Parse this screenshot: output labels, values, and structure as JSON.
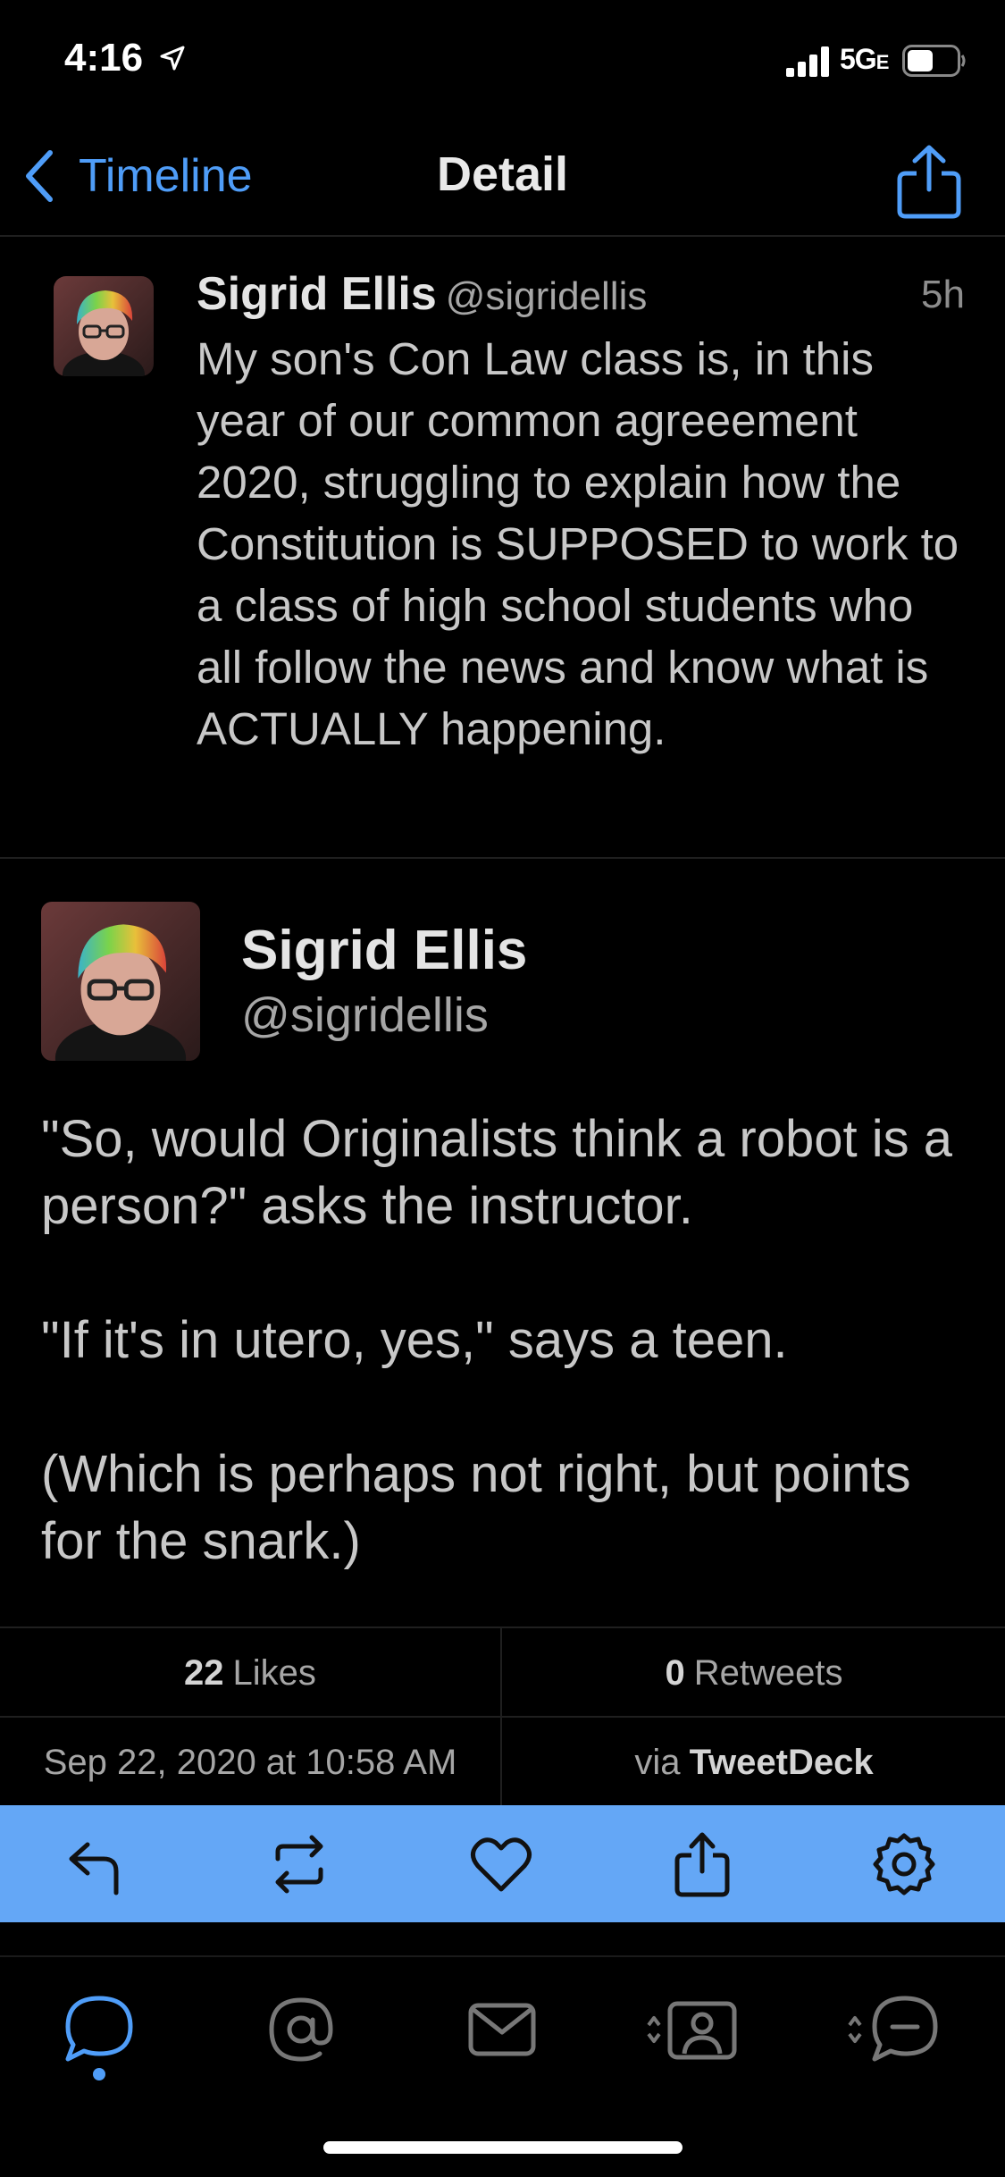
{
  "status_bar": {
    "time": "4:16",
    "network": "5G",
    "network_suffix": "E"
  },
  "nav": {
    "back_label": "Timeline",
    "title": "Detail"
  },
  "parent_tweet": {
    "name": "Sigrid Ellis",
    "handle": "@sigridellis",
    "time": "5h",
    "text": "My son's Con Law class is, in this year of our common agreeement 2020, struggling to explain how the Constitution is SUPPOSED to work to a class of high school students who all follow the news and know what is ACTUALLY happening."
  },
  "main_tweet": {
    "name": "Sigrid Ellis",
    "handle": "@sigridellis",
    "paragraph_1": "\"So, would Originalists think a robot is a person?\" asks the instructor.",
    "paragraph_2": "\"If it's in utero, yes,\" says a teen.",
    "paragraph_3": "(Which is perhaps not right, but points for the snark.)"
  },
  "stats": {
    "likes_count": "22",
    "likes_label": "Likes",
    "retweets_count": "0",
    "retweets_label": "Retweets",
    "date": "Sep 22, 2020 at 10:58 AM",
    "via_label": "via",
    "via_app": "TweetDeck"
  },
  "action_bar": {
    "icons": [
      "reply-icon",
      "retweet-icon",
      "heart-icon",
      "share-icon",
      "settings-icon"
    ],
    "background": "#64a7f6"
  },
  "tab_bar": {
    "icons": [
      "timeline-bubble-icon",
      "mentions-at-icon",
      "messages-envelope-icon",
      "profile-icon",
      "lists-chat-icon"
    ],
    "active_index": 0,
    "accent": "#4f9df8"
  }
}
